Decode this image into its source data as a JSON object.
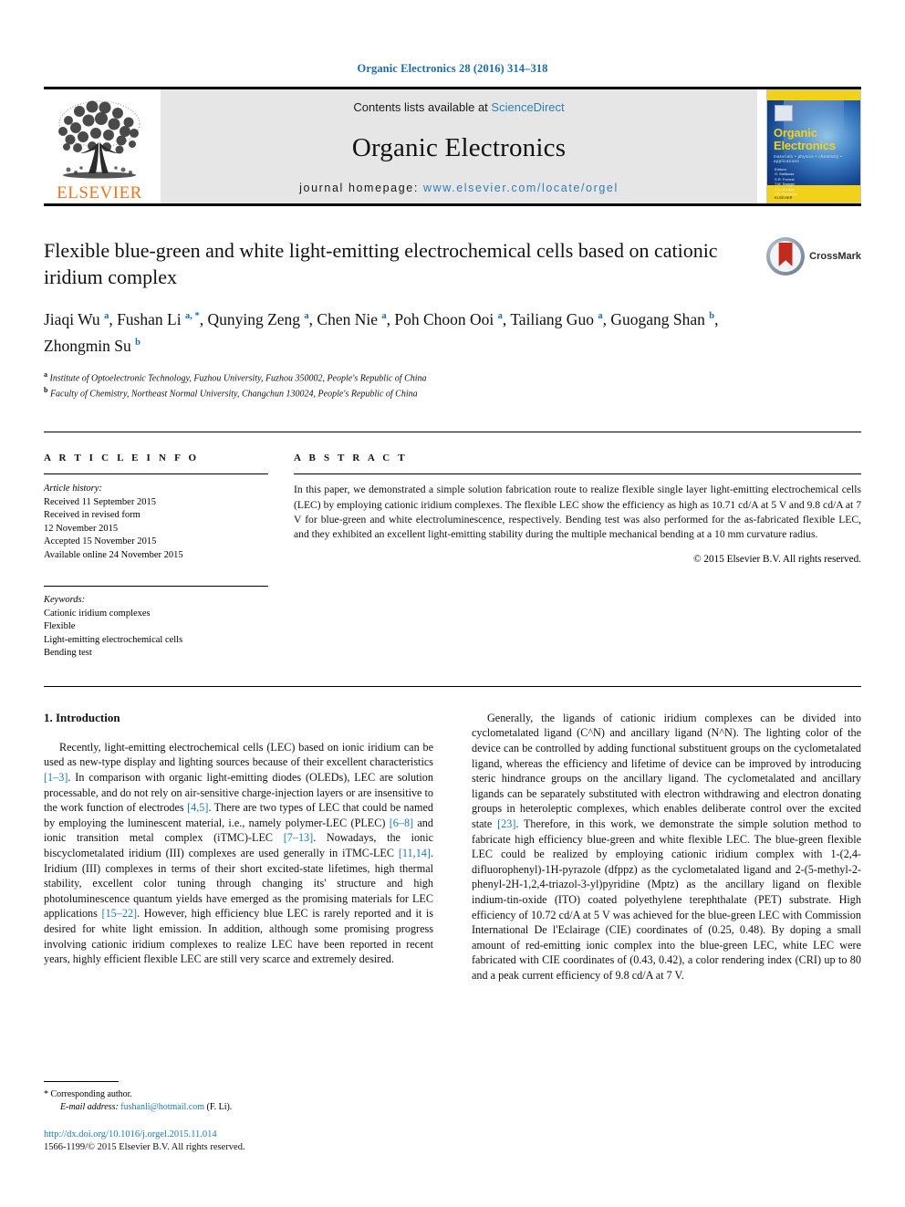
{
  "running_head": "Organic Electronics 28 (2016) 314–318",
  "masthead": {
    "publisher_wordmark": "ELSEVIER",
    "contents_prefix": "Contents lists available at",
    "contents_link": "ScienceDirect",
    "journal_title": "Organic Electronics",
    "homepage_prefix": "journal homepage:",
    "homepage_url": "www.elsevier.com/locate/orgel",
    "cover": {
      "title_line1": "Organic",
      "title_line2": "Electronics",
      "subtitle": "materials • physics • chemistry • applications",
      "editors": "Editors:\nG. Malliaras\nS.R. Forrest\nT.M. Swager\nJ.-L. Brédas\nJ.R. Reynolds",
      "footmark": "ELSEVIER"
    }
  },
  "article": {
    "title": "Flexible blue-green and white light-emitting electrochemical cells based on cationic iridium complex",
    "crossmark_label": "CrossMark",
    "authors_html": "Jiaqi Wu <sup>a</sup>, Fushan Li <sup>a, *</sup>, Qunying Zeng <sup>a</sup>, Chen Nie <sup>a</sup>, Poh Choon Ooi <sup>a</sup>, Tailiang Guo <sup>a</sup>, Guogang Shan <sup>b</sup>, Zhongmin Su <sup>b</sup>",
    "affiliation_a": "Institute of Optoelectronic Technology, Fuzhou University, Fuzhou 350002, People's Republic of China",
    "affiliation_b": "Faculty of Chemistry, Northeast Normal University, Changchun 130024, People's Republic of China"
  },
  "info": {
    "heading": "A R T I C L E    I N F O",
    "history_label": "Article history:",
    "history": [
      "Received 11 September 2015",
      "Received in revised form",
      "12 November 2015",
      "Accepted 15 November 2015",
      "Available online 24 November 2015"
    ],
    "keywords_label": "Keywords:",
    "keywords": [
      "Cationic iridium complexes",
      "Flexible",
      "Light-emitting electrochemical cells",
      "Bending test"
    ]
  },
  "abstract": {
    "heading": "A B S T R A C T",
    "text": "In this paper, we demonstrated a simple solution fabrication route to realize flexible single layer light-emitting electrochemical cells (LEC) by employing cationic iridium complexes. The flexible LEC show the efficiency as high as 10.71 cd/A at 5 V and 9.8 cd/A at 7 V for blue-green and white electroluminescence, respectively. Bending test was also performed for the as-fabricated flexible LEC, and they exhibited an excellent light-emitting stability during the multiple mechanical bending at a 10 mm curvature radius.",
    "copyright": "© 2015 Elsevier B.V. All rights reserved."
  },
  "body": {
    "section_heading": "1. Introduction",
    "left_paragraph_html": "Recently, light-emitting electrochemical cells (LEC) based on ionic iridium can be used as new-type display and lighting sources because of their excellent characteristics <span class=\"cite\">[1–3]</span>. In comparison with organic light-emitting diodes (OLEDs), LEC are solution processable, and do not rely on air-sensitive charge-injection layers or are insensitive to the work function of electrodes <span class=\"cite\">[4,5]</span>. There are two types of LEC that could be named by employing the luminescent material, i.e., namely polymer-LEC (PLEC) <span class=\"cite\">[6–8]</span> and ionic transition metal complex (iTMC)-LEC <span class=\"cite\">[7–13]</span>. Nowadays, the ionic biscyclometalated iridium (III) complexes are used generally in iTMC-LEC <span class=\"cite\">[11,14]</span>. Iridium (III) complexes in terms of their short excited-state lifetimes, high thermal stability, excellent color tuning through changing its' structure and high photoluminescence quantum yields have emerged as the promising materials for LEC applications <span class=\"cite\">[15–22]</span>. However, high efficiency blue LEC is rarely reported and it is desired for white light emission. In addition, although some promising progress involving cationic iridium complexes to realize LEC have been reported in recent years, highly efficient flexible LEC are still very scarce and extremely desired.",
    "right_paragraph_html": "Generally, the ligands of cationic iridium complexes can be divided into cyclometalated ligand (C^N) and ancillary ligand (N^N). The lighting color of the device can be controlled by adding functional substituent groups on the cyclometalated ligand, whereas the efficiency and lifetime of device can be improved by introducing steric hindrance groups on the ancillary ligand. The cyclometalated and ancillary ligands can be separately substituted with electron withdrawing and electron donating groups in heteroleptic complexes, which enables deliberate control over the excited state <span class=\"cite\">[23]</span>. Therefore, in this work, we demonstrate the simple solution method to fabricate high efficiency blue-green and white flexible LEC. The blue-green flexible LEC could be realized by employing cationic iridium complex with 1-(2,4-difluorophenyl)-1H-pyrazole (dfppz) as the cyclometalated ligand and 2-(5-methyl-2-phenyl-2H-1,2,4-triazol-3-yl)pyridine (Mptz) as the ancillary ligand on flexible indium-tin-oxide (ITO) coated polyethylene terephthalate (PET) substrate. High efficiency of 10.72 cd/A at 5 V was achieved for the blue-green LEC with Commission International De l'Eclairage (CIE) coordinates of (0.25, 0.48). By doping a small amount of red-emitting ionic complex into the blue-green LEC, white LEC were fabricated with CIE coordinates of (0.43, 0.42), a color rendering index (CRI) up to 80 and a peak current efficiency of 9.8 cd/A at 7 V."
  },
  "footer": {
    "corresponding": "* Corresponding author.",
    "email_label": "E-mail address:",
    "email": "fushanli@hotmail.com",
    "email_suffix": "(F. Li).",
    "doi": "http://dx.doi.org/10.1016/j.orgel.2015.11.014",
    "issn": "1566-1199/© 2015 Elsevier B.V. All rights reserved."
  },
  "colors": {
    "link": "#1b7ab5",
    "running_head": "#1b6ca8",
    "elsevier_orange": "#e87722",
    "cover_yellow": "#f2d11a",
    "crossmark_red": "#c02b1d"
  }
}
